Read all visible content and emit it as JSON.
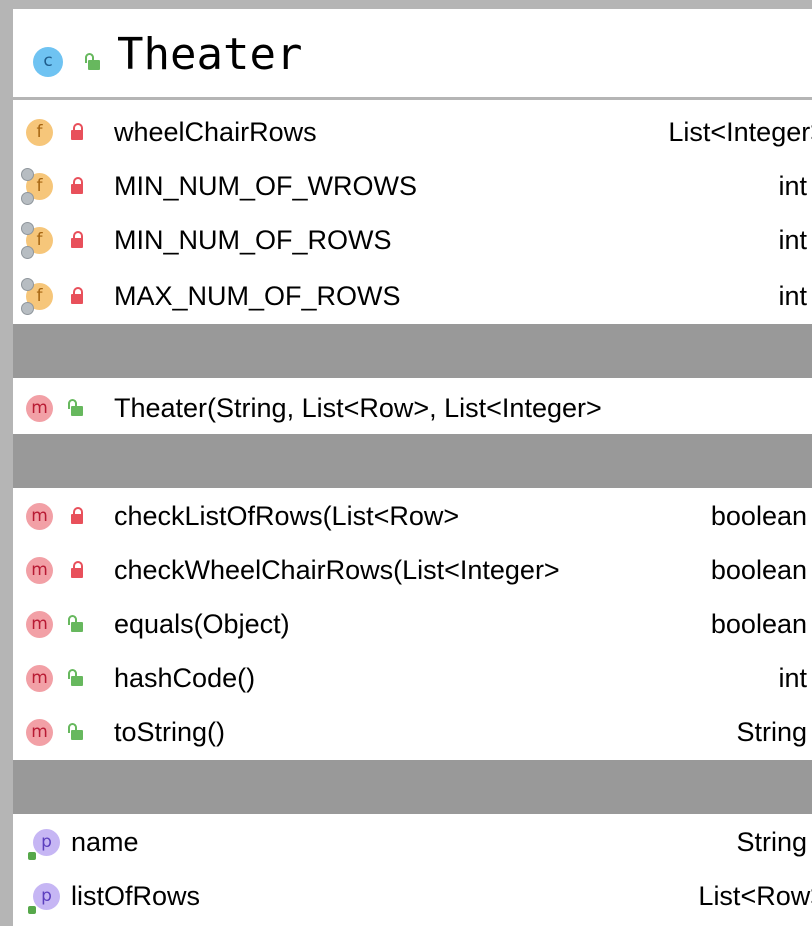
{
  "class": {
    "title": "Theater",
    "icon_letter": "c"
  },
  "fields": [
    {
      "name": "wheelChairRows",
      "type": "List<Integer>",
      "visibility": "private",
      "static": false,
      "icon": "field-icon",
      "icon_letter": "f"
    },
    {
      "name": "MIN_NUM_OF_WROWS",
      "type": "int",
      "visibility": "private",
      "static": true,
      "icon": "static-field-icon",
      "icon_letter": "f"
    },
    {
      "name": "MIN_NUM_OF_ROWS",
      "type": "int",
      "visibility": "private",
      "static": true,
      "icon": "static-field-icon",
      "icon_letter": "f"
    },
    {
      "name": "MAX_NUM_OF_ROWS",
      "type": "int",
      "visibility": "private",
      "static": true,
      "icon": "static-field-icon",
      "icon_letter": "f"
    }
  ],
  "constructors": [
    {
      "name": "Theater(String, List<Row>, List<Integer>",
      "visibility": "public",
      "icon": "method-icon",
      "icon_letter": "m"
    }
  ],
  "methods": [
    {
      "name": "checkListOfRows(List<Row>",
      "type": "boolean",
      "visibility": "private",
      "icon": "method-icon",
      "icon_letter": "m"
    },
    {
      "name": "checkWheelChairRows(List<Integer>",
      "type": "boolean",
      "visibility": "private",
      "icon": "method-icon",
      "icon_letter": "m"
    },
    {
      "name": "equals(Object)",
      "type": "boolean",
      "visibility": "public",
      "icon": "method-icon",
      "icon_letter": "m"
    },
    {
      "name": "hashCode()",
      "type": "int",
      "visibility": "public",
      "icon": "method-icon",
      "icon_letter": "m"
    },
    {
      "name": "toString()",
      "type": "String",
      "visibility": "public",
      "icon": "method-icon",
      "icon_letter": "m"
    }
  ],
  "properties": [
    {
      "name": "name",
      "type": "String",
      "icon": "property-icon",
      "icon_letter": "p"
    },
    {
      "name": "listOfRows",
      "type": "List<Row>",
      "icon": "property-icon",
      "icon_letter": "p"
    }
  ],
  "colors": {
    "border": "#b5b5b5",
    "separator": "#999999",
    "field_icon": "#f6c67a",
    "method_icon": "#f2a0a6",
    "property_icon": "#c6b6f4",
    "class_icon": "#6fc3f2",
    "private_lock": "#e8505b",
    "public_lock": "#67b85e"
  }
}
